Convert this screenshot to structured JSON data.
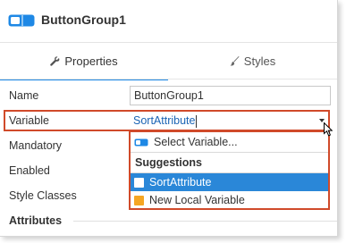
{
  "header": {
    "title": "ButtonGroup1",
    "icon": "toggle-switch-icon"
  },
  "tabs": [
    {
      "label": "Properties",
      "icon": "wrench-icon",
      "active": true
    },
    {
      "label": "Styles",
      "icon": "brush-icon",
      "active": false
    }
  ],
  "properties": {
    "name_label": "Name",
    "name_value": "ButtonGroup1",
    "variable_label": "Variable",
    "variable_value": "SortAttribute",
    "mandatory_label": "Mandatory",
    "enabled_label": "Enabled",
    "style_classes_label": "Style Classes"
  },
  "dropdown": {
    "select_variable": "Select Variable...",
    "suggestions_heading": "Suggestions",
    "options": [
      {
        "label": "SortAttribute",
        "selected": true
      },
      {
        "label": "New Local Variable",
        "selected": false
      }
    ]
  },
  "attributes_heading": "Attributes",
  "colors": {
    "accent": "#1e88e5",
    "highlight_border": "#d04a2a",
    "selected_bg": "#2a87d8",
    "local_var_square": "#f5a623"
  }
}
